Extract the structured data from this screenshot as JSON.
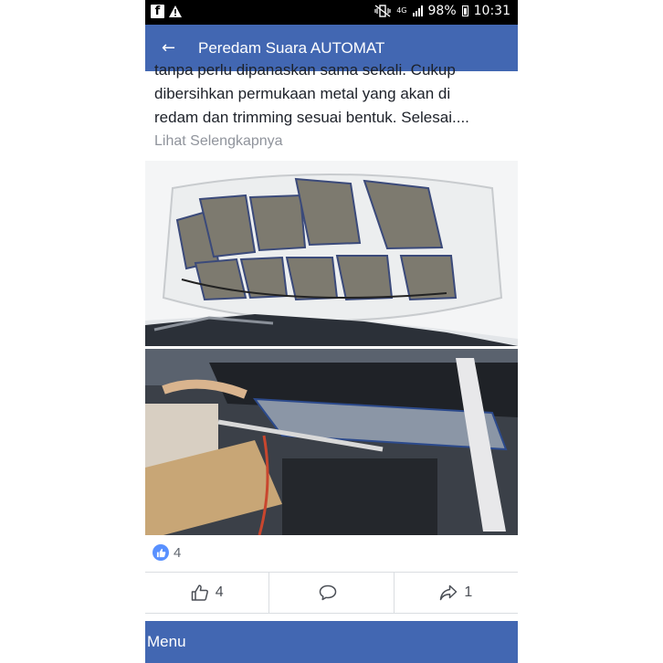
{
  "status_bar": {
    "left_icons": [
      "facebook-icon",
      "alert-icon"
    ],
    "network": "4G",
    "battery": "98%",
    "time": "10:31"
  },
  "app_bar": {
    "title": "Peredam Suara AUTOMAT",
    "back_icon": "arrow-left-icon"
  },
  "post": {
    "lines": [
      "tanpa perlu dipanaskan sama sekali. Cukup",
      "dibersihkan permukaan metal yang akan di",
      "redam dan trimming sesuai bentuk. Selesai...."
    ],
    "see_more": "Lihat Selengkapnya"
  },
  "reactions": {
    "count": "4",
    "icon": "like-badge-icon"
  },
  "actions": {
    "like_count": "4",
    "comment_label": "",
    "share_count": "1"
  },
  "menu": {
    "label": "Menu"
  },
  "colors": {
    "brand_blue": "#4267b2",
    "like_blue": "#5890ff",
    "text_dark": "#1d2129",
    "text_muted": "#90949c"
  }
}
